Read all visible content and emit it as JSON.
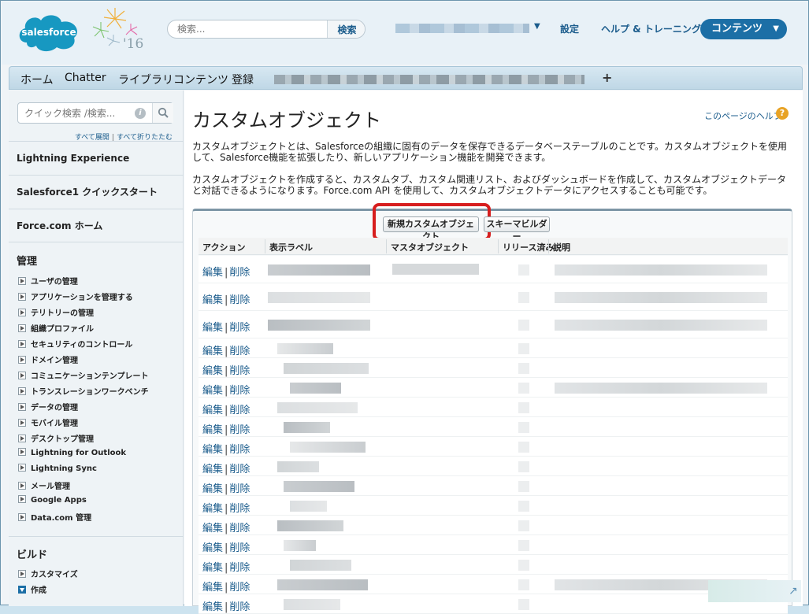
{
  "header": {
    "logo_text": "salesforce",
    "logo_year": "'16",
    "search_placeholder": "検索...",
    "search_button": "検索",
    "settings_link": "設定",
    "help_link": "ヘルプ & トレーニング",
    "app_menu": "コンテンツ"
  },
  "tabs": [
    "ホーム",
    "Chatter",
    "ライブラリ",
    "コンテンツ",
    "登録"
  ],
  "sidebar": {
    "quick_find_placeholder": "クイック検索 /検索...",
    "expand_all": "すべて展開",
    "collapse_all": "すべて折りたたむ",
    "sections": [
      "Lightning Experience",
      "Salesforce1 クイックスタート",
      "Force.com ホーム"
    ],
    "admin_heading": "管理",
    "admin_items": [
      "ユーザの管理",
      "アプリケーションを管理する",
      "テリトリーの管理",
      "組織プロファイル",
      "セキュリティのコントロール",
      "ドメイン管理",
      "コミュニケーションテンプレート",
      "トランスレーションワークベンチ",
      "データの管理",
      "モバイル管理",
      "デスクトップ管理",
      "Lightning for Outlook",
      "Lightning Sync",
      "メール管理",
      "Google Apps",
      "Data.com 管理"
    ],
    "build_heading": "ビルド",
    "build_items": [
      "カスタマイズ",
      "作成"
    ]
  },
  "main": {
    "title": "カスタムオブジェクト",
    "help_link": "このページのヘルプ",
    "desc1": "カスタムオブジェクトとは、Salesforceの組織に固有のデータを保存できるデータベーステーブルのことです。カスタムオブジェクトを使用して、Salesforce機能を拡張したり、新しいアプリケーション機能を開発できます。",
    "desc2": "カスタムオブジェクトを作成すると、カスタムタブ、カスタム関連リスト、およびダッシュボードを作成して、カスタムオブジェクトデータと対話できるようになります。Force.com API を使用して、カスタムオブジェクトデータにアクセスすることも可能です。",
    "new_button": "新規カスタムオブジェクト",
    "schema_button": "スキーマビルダー",
    "columns": [
      "アクション",
      "表示ラベル",
      "マスタオブジェクト",
      "リリース済み",
      "説明"
    ],
    "edit_label": "編集",
    "delete_label": "削除",
    "row_count": 17
  },
  "colors": {
    "brand_blue": "#1c6fa6",
    "link_blue": "#1b5c8c",
    "highlight_red": "#d71e1e"
  }
}
